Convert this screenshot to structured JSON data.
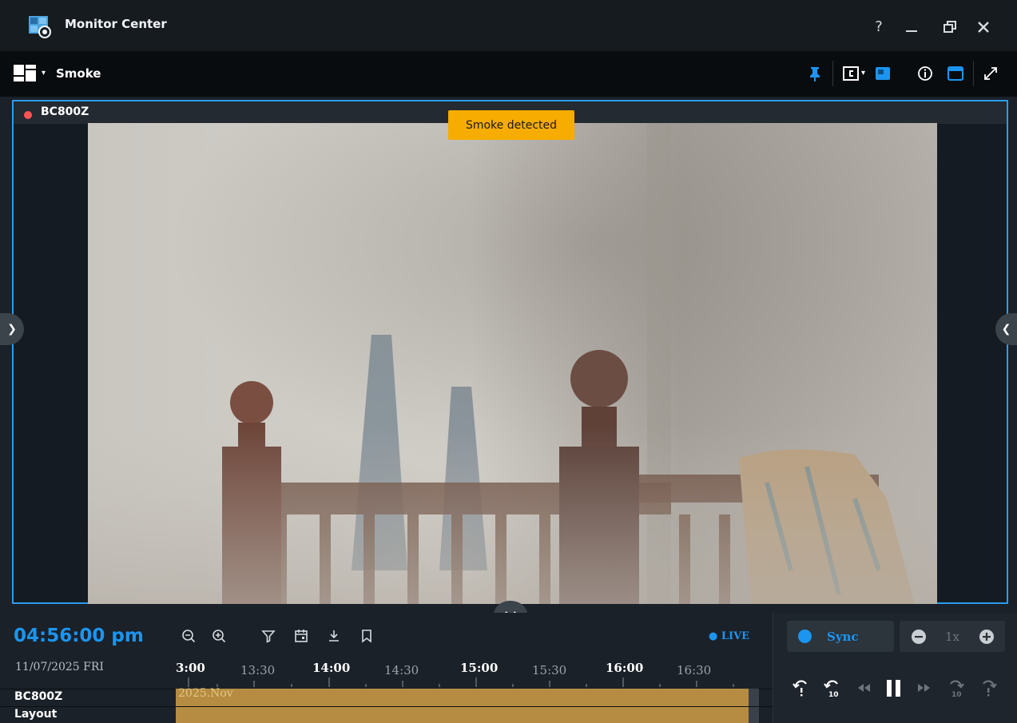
{
  "app": {
    "title": "Monitor Center"
  },
  "window_controls": {
    "help": "?",
    "minimize": "—",
    "restore": "❐",
    "close": "✕"
  },
  "toolbar": {
    "layout_name": "Smoke"
  },
  "camera": {
    "name": "BC800Z",
    "alert": "Smoke detected"
  },
  "timeline": {
    "current_time": "04:56:00 pm",
    "date": "11/07/2025 FRI",
    "live_label": "● LIVE",
    "ticks": [
      {
        "label": "3:00",
        "major": true
      },
      {
        "label": "13:30",
        "major": false
      },
      {
        "label": "14:00",
        "major": true
      },
      {
        "label": "14:30",
        "major": false
      },
      {
        "label": "15:00",
        "major": true
      },
      {
        "label": "15:30",
        "major": false
      },
      {
        "label": "16:00",
        "major": true
      },
      {
        "label": "16:30",
        "major": false
      }
    ],
    "rows": [
      {
        "label": "BC800Z"
      },
      {
        "label": "Layout"
      }
    ],
    "month_label": "2025.Nov"
  },
  "playback": {
    "sync_label": "Sync",
    "speed": "1x"
  },
  "colors": {
    "accent": "#1b95f2",
    "alert": "#f6ac00",
    "track": "#b58c41",
    "record": "#ff5454"
  }
}
